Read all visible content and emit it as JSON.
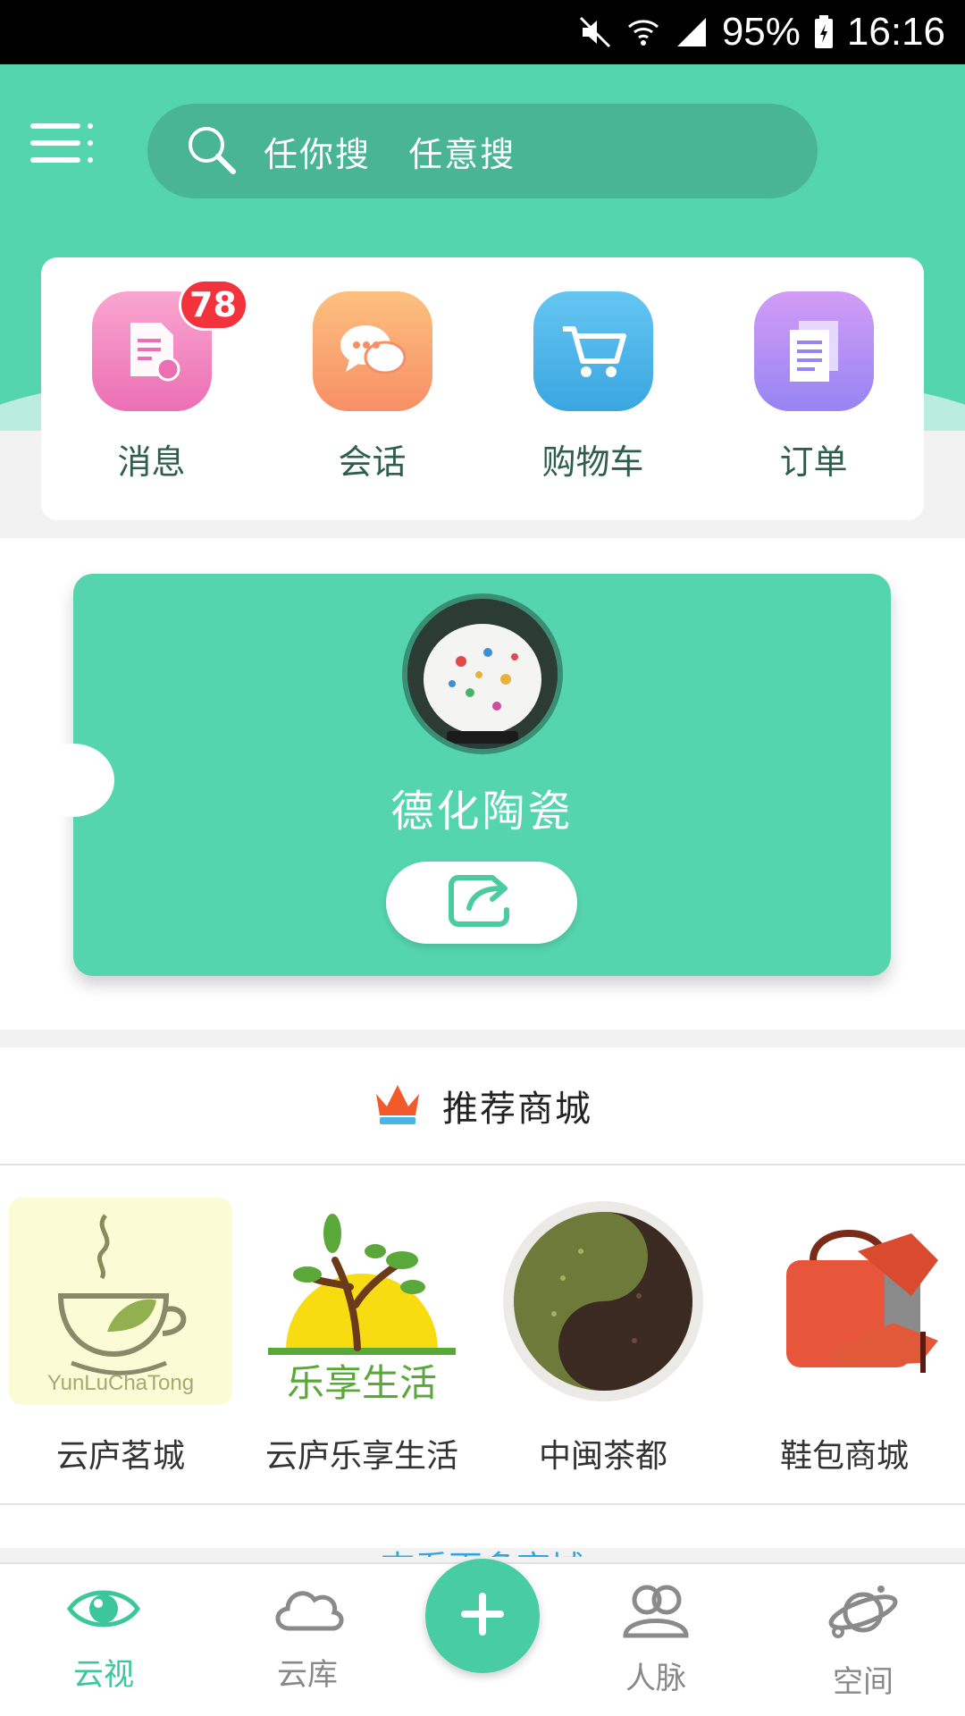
{
  "status_bar": {
    "battery": "95%",
    "time": "16:16"
  },
  "search": {
    "placeholder": "任你搜   任意搜"
  },
  "quick_actions": [
    {
      "label": "消息",
      "badge": "78",
      "icon": "message-doc-icon",
      "color": "#f08bc0"
    },
    {
      "label": "会话",
      "icon": "chat-bubbles-icon",
      "color": "#fbaa6a"
    },
    {
      "label": "购物车",
      "icon": "cart-icon",
      "color": "#4cb7ec"
    },
    {
      "label": "订单",
      "icon": "order-doc-icon",
      "color": "#b08bf5"
    }
  ],
  "shop_card": {
    "name": "德化陶瓷",
    "share_icon": "share-icon"
  },
  "recommended": {
    "title": "推荐商城",
    "stores": [
      {
        "name": "云庐茗城",
        "logo_text": "YunLuChaTong"
      },
      {
        "name": "云庐乐享生活",
        "logo_text": "乐享生活"
      },
      {
        "name": "中闽茶都"
      },
      {
        "name": "鞋包商城"
      }
    ],
    "more_link": "查看更多商城"
  },
  "tabbar": {
    "items": [
      {
        "label": "云视",
        "icon": "eye-icon",
        "active": true
      },
      {
        "label": "云库",
        "icon": "cloud-icon"
      },
      {
        "label": "人脉",
        "icon": "contacts-icon"
      },
      {
        "label": "空间",
        "icon": "planet-icon"
      }
    ],
    "fab_icon": "plus-icon"
  },
  "colors": {
    "brand": "#55d5ad",
    "badge": "#f2323d",
    "link": "#2ea7e0"
  }
}
